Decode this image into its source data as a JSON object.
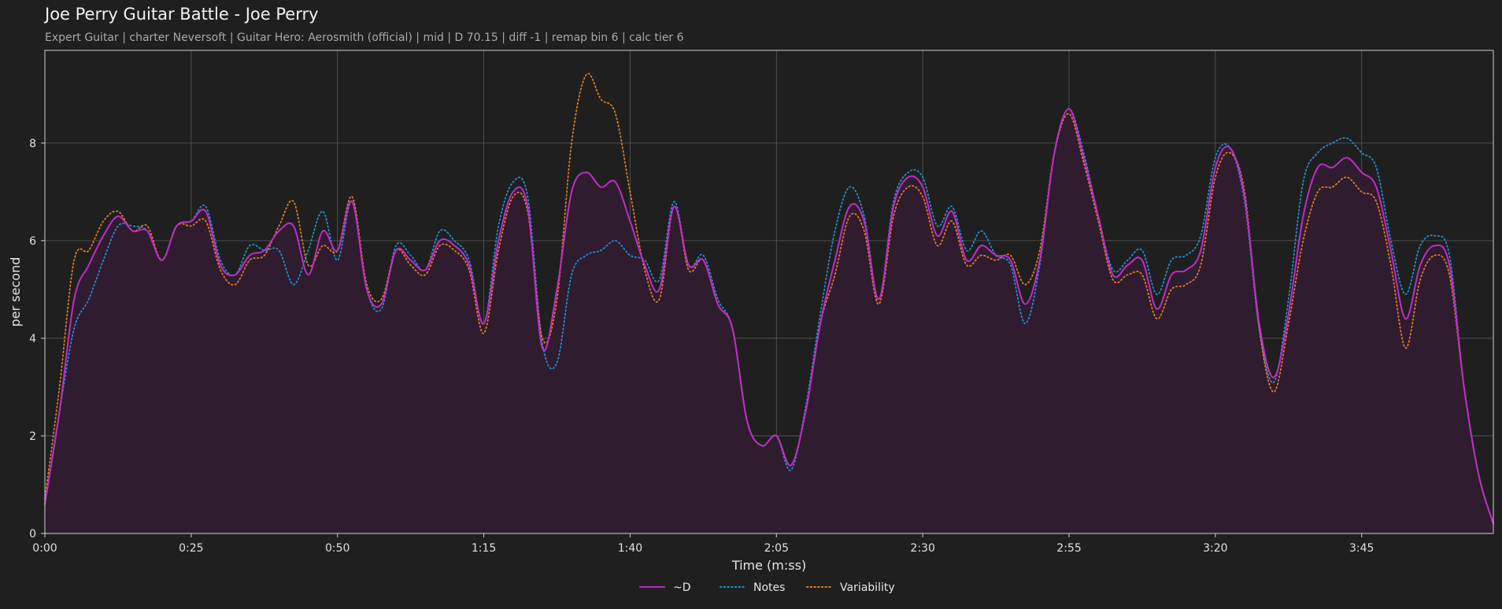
{
  "header": {
    "title": "Joe Perry Guitar Battle - Joe Perry",
    "subtitle": "Expert Guitar  |  charter Neversoft  |  Guitar Hero: Aerosmith (official)  |  mid  |  D 70.15  |  diff -1  |  remap bin 6  |  calc tier 6"
  },
  "colors": {
    "background": "#1f1f1f",
    "grid": "#5a5a5a",
    "axis": "#cfcfcf",
    "fill": "#2f1c2f",
    "d_series": "#c02cc6",
    "notes_series": "#1f8fd0",
    "variability_series": "#e07b22"
  },
  "chart_data": {
    "type": "line",
    "xlabel": "Time (m:ss)",
    "ylabel": "per second",
    "xlim": [
      0,
      297
    ],
    "ylim": [
      0,
      9.9
    ],
    "x_ticks": [
      {
        "value": 0,
        "label": "0:00"
      },
      {
        "value": 30,
        "label": "0:25"
      },
      {
        "value": 60,
        "label": "0:50"
      },
      {
        "value": 90,
        "label": "1:15"
      },
      {
        "value": 120,
        "label": "1:40"
      },
      {
        "value": 150,
        "label": "2:05"
      },
      {
        "value": 180,
        "label": "2:30"
      },
      {
        "value": 210,
        "label": "2:55"
      },
      {
        "value": 240,
        "label": "3:20"
      },
      {
        "value": 270,
        "label": "3:45"
      }
    ],
    "y_ticks": [
      0,
      2,
      4,
      6,
      8
    ],
    "grid": true,
    "legend": "bottom-center",
    "series": [
      {
        "name": "~D",
        "style": "solid",
        "fill": true,
        "points": [
          [
            0,
            0.6
          ],
          [
            3,
            2.5
          ],
          [
            6,
            4.8
          ],
          [
            9,
            5.5
          ],
          [
            12,
            6.1
          ],
          [
            15,
            6.5
          ],
          [
            18,
            6.2
          ],
          [
            21,
            6.2
          ],
          [
            24,
            5.6
          ],
          [
            27,
            6.3
          ],
          [
            30,
            6.4
          ],
          [
            33,
            6.6
          ],
          [
            36,
            5.5
          ],
          [
            39,
            5.3
          ],
          [
            42,
            5.7
          ],
          [
            45,
            5.8
          ],
          [
            48,
            6.2
          ],
          [
            51,
            6.3
          ],
          [
            54,
            5.3
          ],
          [
            57,
            6.2
          ],
          [
            60,
            5.8
          ],
          [
            63,
            6.8
          ],
          [
            66,
            5.0
          ],
          [
            69,
            4.7
          ],
          [
            72,
            5.8
          ],
          [
            75,
            5.6
          ],
          [
            78,
            5.4
          ],
          [
            81,
            6.0
          ],
          [
            84,
            5.9
          ],
          [
            87,
            5.5
          ],
          [
            90,
            4.3
          ],
          [
            93,
            6.0
          ],
          [
            96,
            7.0
          ],
          [
            99,
            6.7
          ],
          [
            102,
            3.8
          ],
          [
            105,
            5.0
          ],
          [
            108,
            7.0
          ],
          [
            111,
            7.4
          ],
          [
            114,
            7.1
          ],
          [
            117,
            7.2
          ],
          [
            120,
            6.4
          ],
          [
            123,
            5.5
          ],
          [
            126,
            5.0
          ],
          [
            129,
            6.7
          ],
          [
            132,
            5.5
          ],
          [
            135,
            5.6
          ],
          [
            138,
            4.7
          ],
          [
            141,
            4.2
          ],
          [
            144,
            2.3
          ],
          [
            147,
            1.8
          ],
          [
            150,
            2.0
          ],
          [
            153,
            1.4
          ],
          [
            156,
            2.5
          ],
          [
            159,
            4.3
          ],
          [
            162,
            5.6
          ],
          [
            165,
            6.7
          ],
          [
            168,
            6.4
          ],
          [
            171,
            4.8
          ],
          [
            174,
            6.7
          ],
          [
            177,
            7.3
          ],
          [
            180,
            7.1
          ],
          [
            183,
            6.1
          ],
          [
            186,
            6.6
          ],
          [
            189,
            5.6
          ],
          [
            192,
            5.9
          ],
          [
            195,
            5.7
          ],
          [
            198,
            5.6
          ],
          [
            201,
            4.7
          ],
          [
            204,
            5.6
          ],
          [
            207,
            7.8
          ],
          [
            210,
            8.7
          ],
          [
            213,
            7.7
          ],
          [
            216,
            6.5
          ],
          [
            219,
            5.3
          ],
          [
            222,
            5.5
          ],
          [
            225,
            5.6
          ],
          [
            228,
            4.6
          ],
          [
            231,
            5.3
          ],
          [
            234,
            5.4
          ],
          [
            237,
            5.8
          ],
          [
            240,
            7.5
          ],
          [
            243,
            7.9
          ],
          [
            246,
            6.9
          ],
          [
            249,
            4.3
          ],
          [
            252,
            3.2
          ],
          [
            255,
            4.5
          ],
          [
            258,
            6.5
          ],
          [
            261,
            7.5
          ],
          [
            264,
            7.5
          ],
          [
            267,
            7.7
          ],
          [
            270,
            7.4
          ],
          [
            273,
            7.1
          ],
          [
            276,
            5.8
          ],
          [
            279,
            4.4
          ],
          [
            282,
            5.5
          ],
          [
            285,
            5.9
          ],
          [
            288,
            5.5
          ],
          [
            291,
            3.0
          ],
          [
            294,
            1.2
          ],
          [
            297,
            0.2
          ]
        ]
      },
      {
        "name": "Notes",
        "style": "dotted",
        "fill": false,
        "points": [
          [
            0,
            0.6
          ],
          [
            3,
            2.5
          ],
          [
            6,
            4.2
          ],
          [
            9,
            4.8
          ],
          [
            12,
            5.6
          ],
          [
            15,
            6.3
          ],
          [
            18,
            6.3
          ],
          [
            21,
            6.2
          ],
          [
            24,
            5.6
          ],
          [
            27,
            6.3
          ],
          [
            30,
            6.4
          ],
          [
            33,
            6.7
          ],
          [
            36,
            5.6
          ],
          [
            39,
            5.3
          ],
          [
            42,
            5.9
          ],
          [
            45,
            5.8
          ],
          [
            48,
            5.8
          ],
          [
            51,
            5.1
          ],
          [
            54,
            5.8
          ],
          [
            57,
            6.6
          ],
          [
            60,
            5.6
          ],
          [
            63,
            6.8
          ],
          [
            66,
            5.0
          ],
          [
            69,
            4.6
          ],
          [
            72,
            5.9
          ],
          [
            75,
            5.7
          ],
          [
            78,
            5.4
          ],
          [
            81,
            6.2
          ],
          [
            84,
            6.0
          ],
          [
            87,
            5.6
          ],
          [
            90,
            4.3
          ],
          [
            93,
            6.3
          ],
          [
            96,
            7.2
          ],
          [
            99,
            6.9
          ],
          [
            102,
            3.9
          ],
          [
            105,
            3.5
          ],
          [
            108,
            5.3
          ],
          [
            111,
            5.7
          ],
          [
            114,
            5.8
          ],
          [
            117,
            6.0
          ],
          [
            120,
            5.7
          ],
          [
            123,
            5.6
          ],
          [
            126,
            5.2
          ],
          [
            129,
            6.8
          ],
          [
            132,
            5.5
          ],
          [
            135,
            5.7
          ],
          [
            138,
            4.8
          ],
          [
            141,
            4.2
          ],
          [
            144,
            2.3
          ],
          [
            147,
            1.8
          ],
          [
            150,
            2.0
          ],
          [
            153,
            1.3
          ],
          [
            156,
            2.6
          ],
          [
            159,
            4.5
          ],
          [
            162,
            6.2
          ],
          [
            165,
            7.1
          ],
          [
            168,
            6.5
          ],
          [
            171,
            4.8
          ],
          [
            174,
            6.8
          ],
          [
            177,
            7.4
          ],
          [
            180,
            7.3
          ],
          [
            183,
            6.3
          ],
          [
            186,
            6.7
          ],
          [
            189,
            5.8
          ],
          [
            192,
            6.2
          ],
          [
            195,
            5.7
          ],
          [
            198,
            5.5
          ],
          [
            201,
            4.3
          ],
          [
            204,
            5.5
          ],
          [
            207,
            7.8
          ],
          [
            210,
            8.7
          ],
          [
            213,
            7.8
          ],
          [
            216,
            6.5
          ],
          [
            219,
            5.4
          ],
          [
            222,
            5.6
          ],
          [
            225,
            5.8
          ],
          [
            228,
            4.9
          ],
          [
            231,
            5.6
          ],
          [
            234,
            5.7
          ],
          [
            237,
            6.1
          ],
          [
            240,
            7.7
          ],
          [
            243,
            7.9
          ],
          [
            246,
            6.8
          ],
          [
            249,
            4.2
          ],
          [
            252,
            3.1
          ],
          [
            255,
            4.8
          ],
          [
            258,
            7.2
          ],
          [
            261,
            7.8
          ],
          [
            264,
            8.0
          ],
          [
            267,
            8.1
          ],
          [
            270,
            7.8
          ],
          [
            273,
            7.5
          ],
          [
            276,
            6.0
          ],
          [
            279,
            4.9
          ],
          [
            282,
            5.9
          ],
          [
            285,
            6.1
          ],
          [
            288,
            5.7
          ],
          [
            291,
            3.0
          ],
          [
            294,
            1.2
          ],
          [
            297,
            0.2
          ]
        ]
      },
      {
        "name": "Variability",
        "style": "dotted",
        "fill": false,
        "points": [
          [
            0,
            0.7
          ],
          [
            3,
            3.0
          ],
          [
            6,
            5.6
          ],
          [
            9,
            5.8
          ],
          [
            12,
            6.4
          ],
          [
            15,
            6.6
          ],
          [
            18,
            6.2
          ],
          [
            21,
            6.3
          ],
          [
            24,
            5.6
          ],
          [
            27,
            6.3
          ],
          [
            30,
            6.3
          ],
          [
            33,
            6.4
          ],
          [
            36,
            5.4
          ],
          [
            39,
            5.1
          ],
          [
            42,
            5.6
          ],
          [
            45,
            5.7
          ],
          [
            48,
            6.3
          ],
          [
            51,
            6.8
          ],
          [
            54,
            5.5
          ],
          [
            57,
            5.9
          ],
          [
            60,
            5.8
          ],
          [
            63,
            6.9
          ],
          [
            66,
            5.1
          ],
          [
            69,
            4.8
          ],
          [
            72,
            5.8
          ],
          [
            75,
            5.5
          ],
          [
            78,
            5.3
          ],
          [
            81,
            5.9
          ],
          [
            84,
            5.8
          ],
          [
            87,
            5.4
          ],
          [
            90,
            4.1
          ],
          [
            93,
            5.8
          ],
          [
            96,
            6.9
          ],
          [
            99,
            6.6
          ],
          [
            102,
            4.0
          ],
          [
            105,
            4.8
          ],
          [
            108,
            8.0
          ],
          [
            111,
            9.4
          ],
          [
            114,
            8.9
          ],
          [
            117,
            8.6
          ],
          [
            120,
            7.0
          ],
          [
            123,
            5.4
          ],
          [
            126,
            4.8
          ],
          [
            129,
            6.7
          ],
          [
            132,
            5.4
          ],
          [
            135,
            5.6
          ],
          [
            138,
            4.7
          ],
          [
            141,
            4.2
          ],
          [
            144,
            2.3
          ],
          [
            147,
            1.8
          ],
          [
            150,
            2.0
          ],
          [
            153,
            1.4
          ],
          [
            156,
            2.5
          ],
          [
            159,
            4.3
          ],
          [
            162,
            5.3
          ],
          [
            165,
            6.5
          ],
          [
            168,
            6.2
          ],
          [
            171,
            4.7
          ],
          [
            174,
            6.5
          ],
          [
            177,
            7.1
          ],
          [
            180,
            6.9
          ],
          [
            183,
            5.9
          ],
          [
            186,
            6.4
          ],
          [
            189,
            5.5
          ],
          [
            192,
            5.7
          ],
          [
            195,
            5.6
          ],
          [
            198,
            5.7
          ],
          [
            201,
            5.1
          ],
          [
            204,
            5.8
          ],
          [
            207,
            7.8
          ],
          [
            210,
            8.6
          ],
          [
            213,
            7.6
          ],
          [
            216,
            6.4
          ],
          [
            219,
            5.2
          ],
          [
            222,
            5.3
          ],
          [
            225,
            5.3
          ],
          [
            228,
            4.4
          ],
          [
            231,
            5.0
          ],
          [
            234,
            5.1
          ],
          [
            237,
            5.5
          ],
          [
            240,
            7.3
          ],
          [
            243,
            7.8
          ],
          [
            246,
            7.0
          ],
          [
            249,
            4.2
          ],
          [
            252,
            2.9
          ],
          [
            255,
            4.3
          ],
          [
            258,
            6.0
          ],
          [
            261,
            7.0
          ],
          [
            264,
            7.1
          ],
          [
            267,
            7.3
          ],
          [
            270,
            7.0
          ],
          [
            273,
            6.8
          ],
          [
            276,
            5.5
          ],
          [
            279,
            3.8
          ],
          [
            282,
            5.2
          ],
          [
            285,
            5.7
          ],
          [
            288,
            5.3
          ],
          [
            291,
            3.0
          ],
          [
            294,
            1.2
          ],
          [
            297,
            0.2
          ]
        ]
      }
    ]
  }
}
